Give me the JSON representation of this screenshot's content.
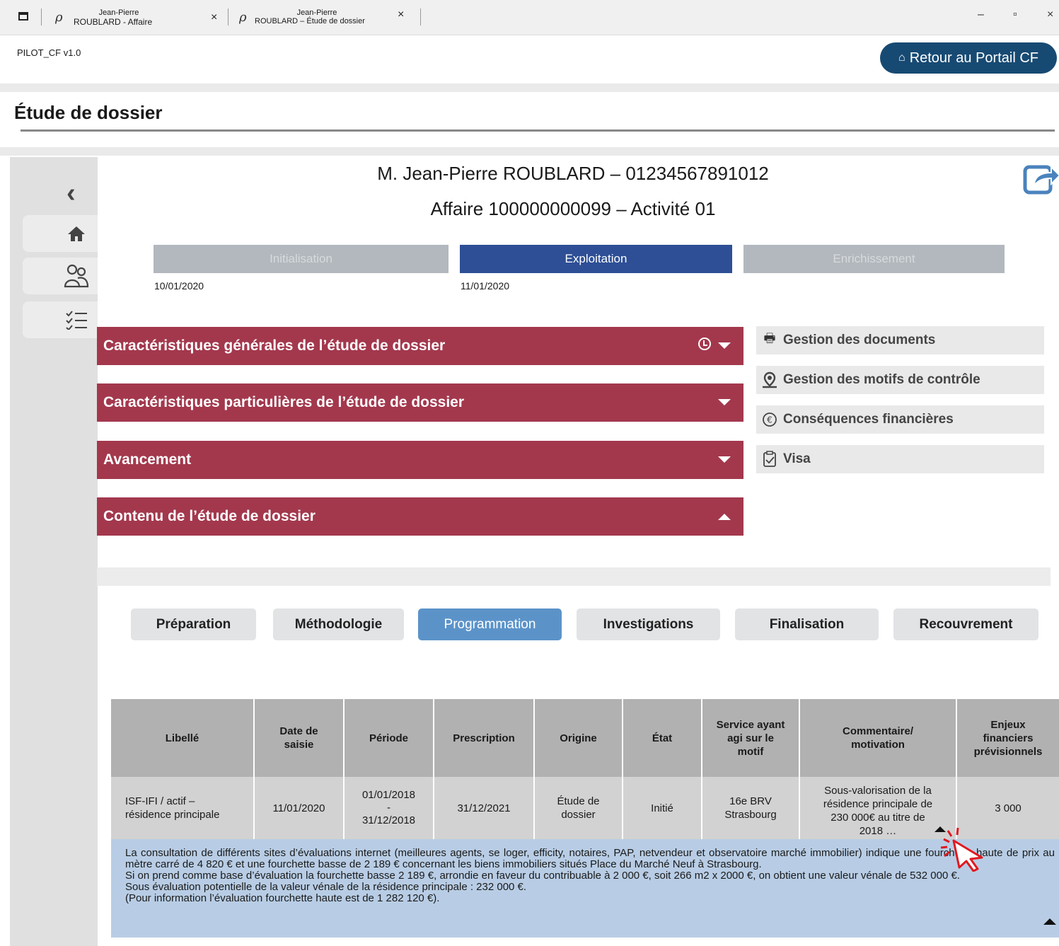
{
  "browser": {
    "tabs": [
      {
        "line1": "Jean-Pierre",
        "line2": "ROUBLARD - Affaire"
      },
      {
        "line1": "Jean-Pierre",
        "line2": "ROUBLARD – Étude de dossier"
      }
    ],
    "close_glyph": "×",
    "minimize_glyph": "–",
    "restore_glyph": "▫",
    "window_close_glyph": "×"
  },
  "app": {
    "name": "PILOT_CF v1.0",
    "portal_button": "Retour au Portail CF",
    "page_title": "Étude de dossier"
  },
  "header": {
    "person": "M. Jean-Pierre ROUBLARD – 01234567891012",
    "affaire": "Affaire 100000000099 – Activité 01"
  },
  "steps": [
    {
      "label": "Initialisation",
      "date": "10/01/2020",
      "state": "done"
    },
    {
      "label": "Exploitation",
      "date": "11/01/2020",
      "state": "active"
    },
    {
      "label": "Enrichissement",
      "date": "",
      "state": "pending"
    }
  ],
  "accordion": [
    {
      "label": "Caractéristiques générales de l’étude de dossier",
      "expanded": false,
      "has_clock": true
    },
    {
      "label": "Caractéristiques particulières de l’étude de dossier",
      "expanded": false
    },
    {
      "label": "Avancement",
      "expanded": false
    },
    {
      "label": "Contenu de l’étude de dossier",
      "expanded": true
    }
  ],
  "side_panel": [
    {
      "label": "Gestion des documents",
      "icon": "documents-icon"
    },
    {
      "label": "Gestion des motifs de contrôle",
      "icon": "location-person-icon"
    },
    {
      "label": "Conséquences financières",
      "icon": "euro-cycle-icon"
    },
    {
      "label": "Visa",
      "icon": "clipboard-check-icon"
    }
  ],
  "sub_tabs": [
    {
      "label": "Préparation",
      "active": false
    },
    {
      "label": "Méthodologie",
      "active": false
    },
    {
      "label": "Programmation",
      "active": true
    },
    {
      "label": "Investigations",
      "active": false
    },
    {
      "label": "Finalisation",
      "active": false
    },
    {
      "label": "Recouvrement",
      "active": false
    }
  ],
  "table": {
    "headers": [
      "Libellé",
      "Date de saisie",
      "Période",
      "Prescription",
      "Origine",
      "État",
      "Service ayant agi sur le motif",
      "Commentaire/ motivation",
      "Enjeux financiers prévisionnels"
    ],
    "rows": [
      {
        "libelle": "ISF-IFI / actif – résidence principale",
        "date_saisie": "11/01/2020",
        "periode_debut": "01/01/2018",
        "periode_sep": "-",
        "periode_fin": "31/12/2018",
        "prescription": "31/12/2021",
        "origine": "Étude de dossier",
        "etat": "Initié",
        "service": "16e BRV Strasbourg",
        "commentaire": "Sous-valorisation de la résidence principale de 230 000€ au titre de 2018 …",
        "enjeux": "3 000"
      }
    ],
    "detail": [
      "La consultation de différents sites d’évaluations internet (meilleures agents, se loger, efficity, notaires, PAP, netvendeur et observatoire marché immobilier) indique une fourchette haute de prix au mètre carré de 4 820 € et une fourchette basse de 2 189 € concernant les biens immobiliers situés Place du Marché Neuf à Strasbourg.",
      "Si on prend comme base d’évaluation la fourchette basse 2 189 €, arrondie en faveur du contribuable à 2 000 €, soit 266 m2 x 2000 €, on obtient une valeur vénale de 532 000 €.",
      "Sous évaluation potentielle de la valeur vénale de la résidence principale : 232 000 €.",
      "(Pour information l’évaluation fourchette haute est de 1 282 120 €)."
    ]
  },
  "colors": {
    "accordion": "#a3384d",
    "step_active": "#2e4f96",
    "step_inactive": "#b2b8be",
    "subtab_active": "#5b93c9",
    "portal_button": "#174a73",
    "detail_bg": "#b8cde5",
    "cursor": "#e0191f"
  }
}
